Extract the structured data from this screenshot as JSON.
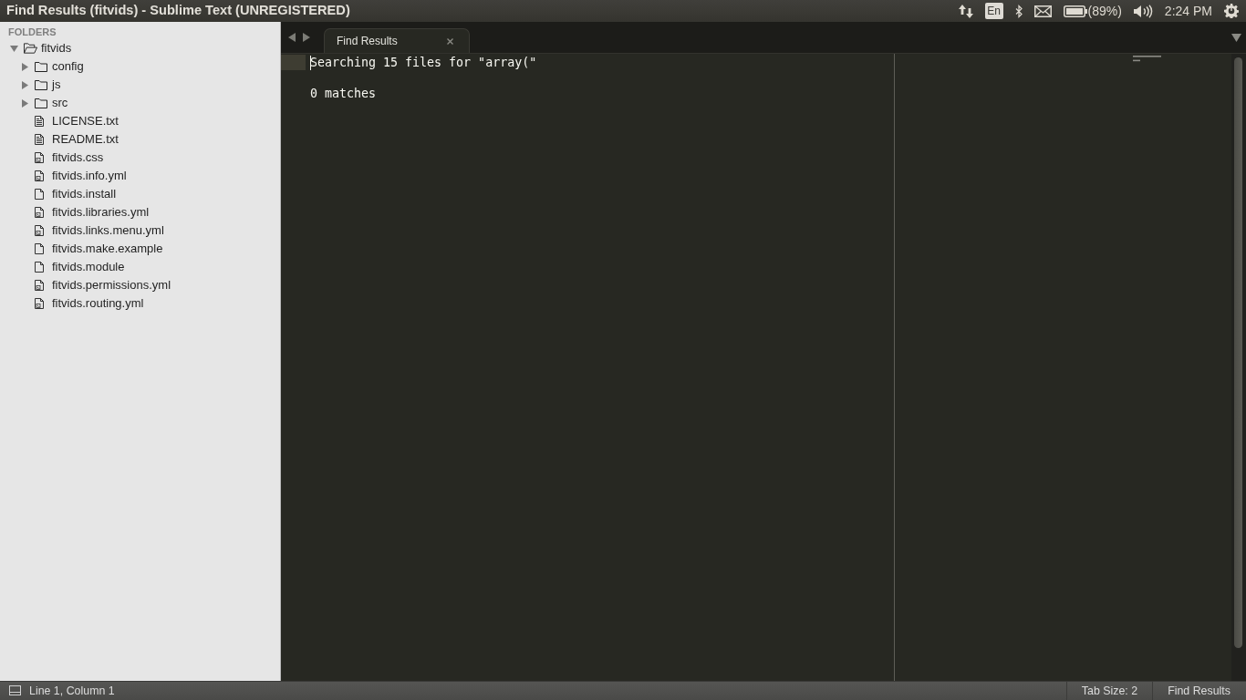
{
  "window": {
    "title": "Find Results (fitvids) - Sublime Text (UNREGISTERED)"
  },
  "top_panel": {
    "keyboard_layout": "En",
    "battery": "(89%)",
    "clock": "2:24 PM"
  },
  "sidebar": {
    "header": "FOLDERS",
    "tree": [
      {
        "name": "fitvids",
        "kind": "folder",
        "expanded": true,
        "children": [
          {
            "name": "config",
            "kind": "folder",
            "expanded": false
          },
          {
            "name": "js",
            "kind": "folder",
            "expanded": false
          },
          {
            "name": "src",
            "kind": "folder",
            "expanded": false
          },
          {
            "name": "LICENSE.txt",
            "kind": "text-file"
          },
          {
            "name": "README.txt",
            "kind": "text-file"
          },
          {
            "name": "fitvids.css",
            "kind": "code-file"
          },
          {
            "name": "fitvids.info.yml",
            "kind": "code-file"
          },
          {
            "name": "fitvids.install",
            "kind": "file"
          },
          {
            "name": "fitvids.libraries.yml",
            "kind": "code-file"
          },
          {
            "name": "fitvids.links.menu.yml",
            "kind": "code-file"
          },
          {
            "name": "fitvids.make.example",
            "kind": "file"
          },
          {
            "name": "fitvids.module",
            "kind": "file"
          },
          {
            "name": "fitvids.permissions.yml",
            "kind": "code-file"
          },
          {
            "name": "fitvids.routing.yml",
            "kind": "code-file"
          }
        ]
      }
    ]
  },
  "editor": {
    "tabs": [
      {
        "label": "Find Results",
        "selected": true
      }
    ],
    "lines": [
      {
        "kind": "text",
        "text": "Searching 15 files for \"array(\"",
        "cursor": true
      },
      {
        "kind": "blank",
        "cursor": false
      },
      {
        "kind": "text",
        "text": "0 matches",
        "cursor": false
      }
    ]
  },
  "status_bar": {
    "position": "Line 1, Column 1",
    "tab_size": "Tab Size: 2",
    "syntax": "Find Results"
  }
}
